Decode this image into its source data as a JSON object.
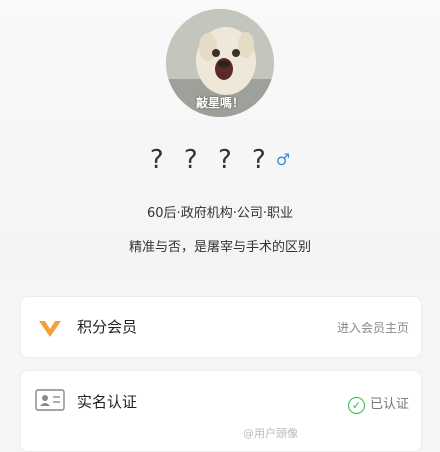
{
  "profile": {
    "avatar_caption": "敲星嗎！",
    "name": "? ? ? ?",
    "gender_icon": "male-icon",
    "tags": "60后·政府机构·公司·职业",
    "bio": "精准与否，是屠宰与手术的区别"
  },
  "cards": {
    "member": {
      "label": "积分会员",
      "right_text": "进入会员主页",
      "icon": "v-badge-icon"
    },
    "verify": {
      "label": "实名认证",
      "status": "已认证",
      "icon": "id-card-icon"
    }
  },
  "watermark": "@用户頭像",
  "colors": {
    "verified": "#3bb34a",
    "vip": "#f5a03a",
    "gender": "#3b8ae0"
  }
}
